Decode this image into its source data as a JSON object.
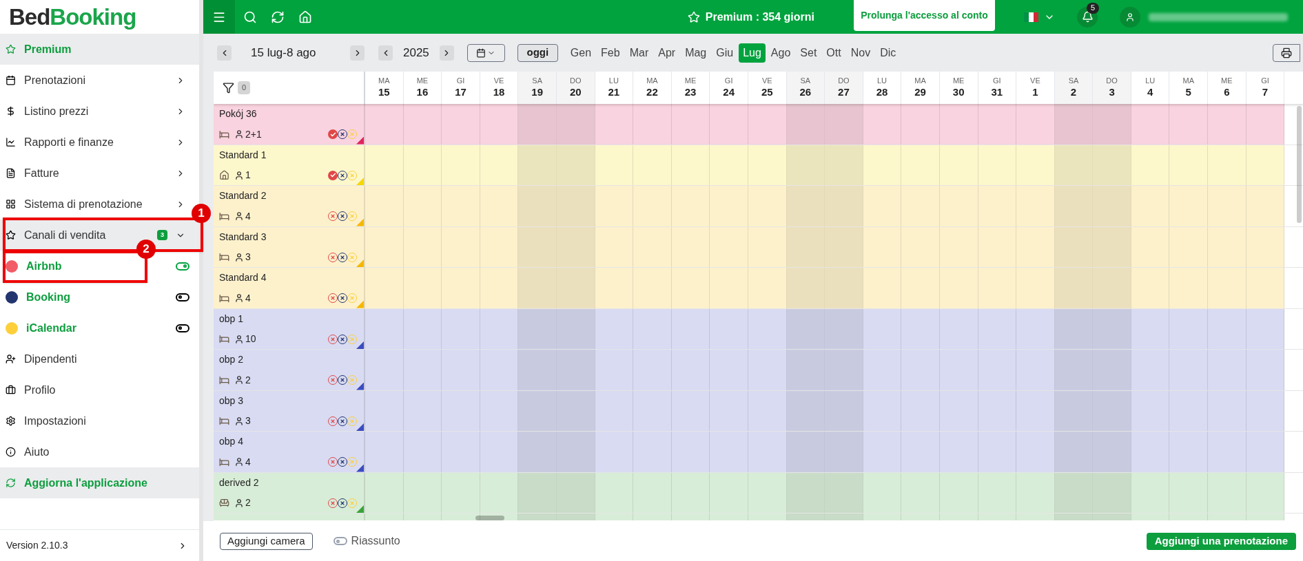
{
  "logo": {
    "part1": "Bed",
    "part2": "Booking"
  },
  "sidebar": {
    "items": [
      {
        "kind": "highlight",
        "label": "Premium"
      },
      {
        "kind": "menu",
        "label": "Prenotazioni"
      },
      {
        "kind": "menu",
        "label": "Listino prezzi"
      },
      {
        "kind": "menu",
        "label": "Rapporti e finanze"
      },
      {
        "kind": "menu",
        "label": "Fatture"
      },
      {
        "kind": "menu",
        "label": "Sistema di prenotazione"
      },
      {
        "kind": "section",
        "label": "Canali di vendita",
        "badge": "3",
        "expanded": true
      },
      {
        "kind": "channel",
        "label": "Airbnb",
        "color": "#f25c66",
        "on": true
      },
      {
        "kind": "channel",
        "label": "Booking",
        "color": "#22356f",
        "on": false
      },
      {
        "kind": "channel",
        "label": "iCalendar",
        "color": "#fdd03b",
        "on": false
      },
      {
        "kind": "link",
        "label": "Dipendenti"
      },
      {
        "kind": "link",
        "label": "Profilo"
      },
      {
        "kind": "link",
        "label": "Impostazioni"
      },
      {
        "kind": "link",
        "label": "Aiuto"
      },
      {
        "kind": "highlight",
        "label": "Aggiorna l'applicazione"
      }
    ],
    "version": "Version 2.10.3"
  },
  "callouts": [
    {
      "number": "1"
    },
    {
      "number": "2"
    }
  ],
  "topbar": {
    "premium": "Premium : **354 giorni**",
    "extend_button": "Prolunga l'accesso al conto",
    "notifications": "5"
  },
  "toolbar": {
    "range": "15 lug-8 ago",
    "year": "2025",
    "today": "oggi",
    "months": [
      {
        "label": "Gen",
        "selected": false
      },
      {
        "label": "Feb",
        "selected": false
      },
      {
        "label": "Mar",
        "selected": false
      },
      {
        "label": "Apr",
        "selected": false
      },
      {
        "label": "Mag",
        "selected": false
      },
      {
        "label": "Giu",
        "selected": false
      },
      {
        "label": "Lug",
        "selected": true
      },
      {
        "label": "Ago",
        "selected": false
      },
      {
        "label": "Set",
        "selected": false
      },
      {
        "label": "Ott",
        "selected": false
      },
      {
        "label": "Nov",
        "selected": false
      },
      {
        "label": "Dic",
        "selected": false
      }
    ]
  },
  "filter_count": "0",
  "days": [
    {
      "dow": "MA",
      "day": "15",
      "weekend": false
    },
    {
      "dow": "ME",
      "day": "16",
      "weekend": false
    },
    {
      "dow": "GI",
      "day": "17",
      "weekend": false
    },
    {
      "dow": "VE",
      "day": "18",
      "weekend": false
    },
    {
      "dow": "SA",
      "day": "19",
      "weekend": true
    },
    {
      "dow": "DO",
      "day": "20",
      "weekend": true
    },
    {
      "dow": "LU",
      "day": "21",
      "weekend": false
    },
    {
      "dow": "MA",
      "day": "22",
      "weekend": false
    },
    {
      "dow": "ME",
      "day": "23",
      "weekend": false
    },
    {
      "dow": "GI",
      "day": "24",
      "weekend": false
    },
    {
      "dow": "VE",
      "day": "25",
      "weekend": false
    },
    {
      "dow": "SA",
      "day": "26",
      "weekend": true
    },
    {
      "dow": "DO",
      "day": "27",
      "weekend": true
    },
    {
      "dow": "LU",
      "day": "28",
      "weekend": false
    },
    {
      "dow": "MA",
      "day": "29",
      "weekend": false
    },
    {
      "dow": "ME",
      "day": "30",
      "weekend": false
    },
    {
      "dow": "GI",
      "day": "31",
      "weekend": false
    },
    {
      "dow": "VE",
      "day": "1",
      "weekend": false
    },
    {
      "dow": "SA",
      "day": "2",
      "weekend": true
    },
    {
      "dow": "DO",
      "day": "3",
      "weekend": true
    },
    {
      "dow": "LU",
      "day": "4",
      "weekend": false
    },
    {
      "dow": "MA",
      "day": "5",
      "weekend": false
    },
    {
      "dow": "ME",
      "day": "6",
      "weekend": false
    },
    {
      "dow": "GI",
      "day": "7",
      "weekend": false
    }
  ],
  "rooms": [
    {
      "name": "Pokój 36",
      "kind": "bed",
      "guests": "2+1",
      "color": "#e0245e",
      "airbnb_connected": true
    },
    {
      "name": "Standard 1",
      "kind": "house",
      "guests": "1",
      "color": "#f5d800",
      "airbnb_connected": true
    },
    {
      "name": "Standard 2",
      "kind": "bed",
      "guests": "4",
      "color": "#f5b800",
      "airbnb_connected": false
    },
    {
      "name": "Standard 3",
      "kind": "bed",
      "guests": "3",
      "color": "#f5b800",
      "airbnb_connected": false
    },
    {
      "name": "Standard 4",
      "kind": "bed",
      "guests": "4",
      "color": "#f5b800",
      "airbnb_connected": false
    },
    {
      "name": "obp 1",
      "kind": "bed",
      "guests": "10",
      "color": "#3b4cc0",
      "airbnb_connected": false
    },
    {
      "name": "obp 2",
      "kind": "bed",
      "guests": "2",
      "color": "#3b4cc0",
      "airbnb_connected": false
    },
    {
      "name": "obp 3",
      "kind": "bed",
      "guests": "3",
      "color": "#3b4cc0",
      "airbnb_connected": false
    },
    {
      "name": "obp 4",
      "kind": "bed",
      "guests": "4",
      "color": "#3b4cc0",
      "airbnb_connected": false
    },
    {
      "name": "derived 2",
      "kind": "sofa",
      "guests": "2",
      "color": "#3aa43a",
      "airbnb_connected": false
    }
  ],
  "footer": {
    "add_room": "Aggiungi camera",
    "summary": {
      "label": "Riassunto",
      "on": false
    },
    "add_booking": "Aggiungi una prenotazione"
  }
}
